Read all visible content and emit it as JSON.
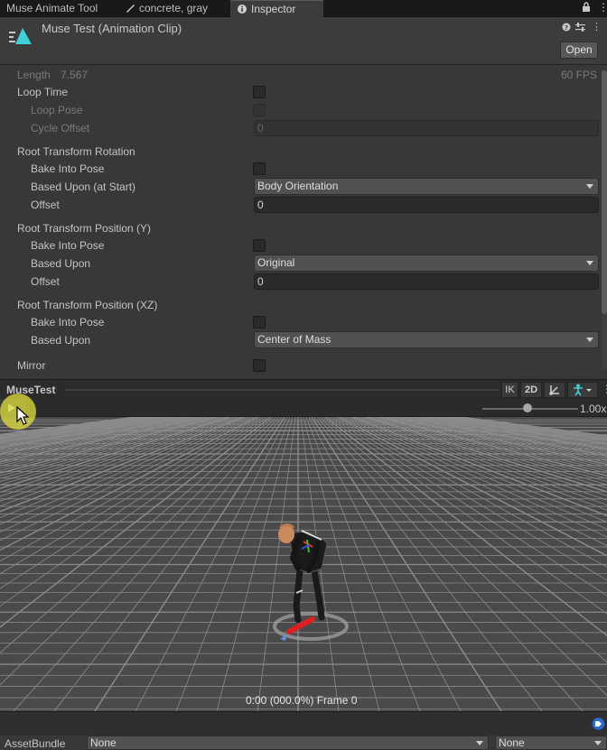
{
  "tabs": [
    {
      "label": "Muse Animate Tool",
      "icon": ""
    },
    {
      "label": "concrete, gray",
      "icon": "brush-icon"
    },
    {
      "label": "Inspector",
      "icon": "info-icon"
    }
  ],
  "inspector": {
    "title": "Muse Test (Animation Clip)",
    "open_label": "Open"
  },
  "props": {
    "length_label": "Length",
    "length_value": "7.567",
    "fps": "60 FPS",
    "loop_time": "Loop Time",
    "loop_pose": "Loop Pose",
    "cycle_offset": "Cycle Offset",
    "cycle_offset_value": "0",
    "rtr_header": "Root Transform Rotation",
    "rtr_bake": "Bake Into Pose",
    "rtr_based": "Based Upon (at Start)",
    "rtr_based_value": "Body Orientation",
    "rtr_offset": "Offset",
    "rtr_offset_value": "0",
    "rtpy_header": "Root Transform Position (Y)",
    "rtpy_bake": "Bake Into Pose",
    "rtpy_based": "Based Upon",
    "rtpy_based_value": "Original",
    "rtpy_offset": "Offset",
    "rtpy_offset_value": "0",
    "rtpxz_header": "Root Transform Position (XZ)",
    "rtpxz_bake": "Bake Into Pose",
    "rtpxz_based": "Based Upon",
    "rtpxz_based_value": "Center of Mass",
    "mirror": "Mirror"
  },
  "preview": {
    "title": "MuseTest",
    "ik": "IK",
    "two_d": "2D",
    "speed": "1.00x",
    "time_readout": "0:00 (000.0%) Frame 0"
  },
  "asset_bundle": {
    "label": "AssetBundle",
    "name_value": "None",
    "variant_value": "None"
  },
  "colors": {
    "accent_clip_icon": "#3fd0d8",
    "cursor_highlight": "#e0e03c"
  }
}
